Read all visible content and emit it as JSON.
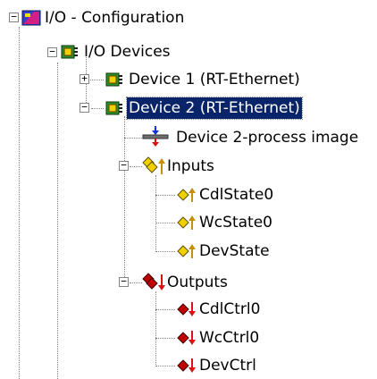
{
  "tree": {
    "root": {
      "label": "I/O - Configuration",
      "toggle": "−",
      "icon": "config-icon"
    },
    "io_devices": {
      "label": "I/O Devices",
      "toggle": "−",
      "icon": "device-card-icon"
    },
    "device1": {
      "label": "Device 1 (RT-Ethernet)",
      "toggle": "+",
      "icon": "device-card-icon"
    },
    "device2": {
      "label": "Device 2 (RT-Ethernet)",
      "toggle": "−",
      "icon": "device-card-icon",
      "selected": true
    },
    "process_image": {
      "label": "Device 2-process image",
      "icon": "process-image-icon"
    },
    "inputs": {
      "label": "Inputs",
      "toggle": "−",
      "icon": "inputs-group-icon",
      "items": [
        {
          "label": "CdlState0",
          "icon": "input-variable-icon"
        },
        {
          "label": "WcState0",
          "icon": "input-variable-icon"
        },
        {
          "label": "DevState",
          "icon": "input-variable-icon"
        }
      ]
    },
    "outputs": {
      "label": "Outputs",
      "toggle": "−",
      "icon": "outputs-group-icon",
      "items": [
        {
          "label": "CdlCtrl0",
          "icon": "output-variable-icon"
        },
        {
          "label": "WcCtrl0",
          "icon": "output-variable-icon"
        },
        {
          "label": "DevCtrl",
          "icon": "output-variable-icon"
        }
      ]
    }
  },
  "colors": {
    "selection": "#0a246a",
    "input_yellow": "#f0d000",
    "output_red": "#c00000",
    "card_green": "#2f8f2f"
  }
}
